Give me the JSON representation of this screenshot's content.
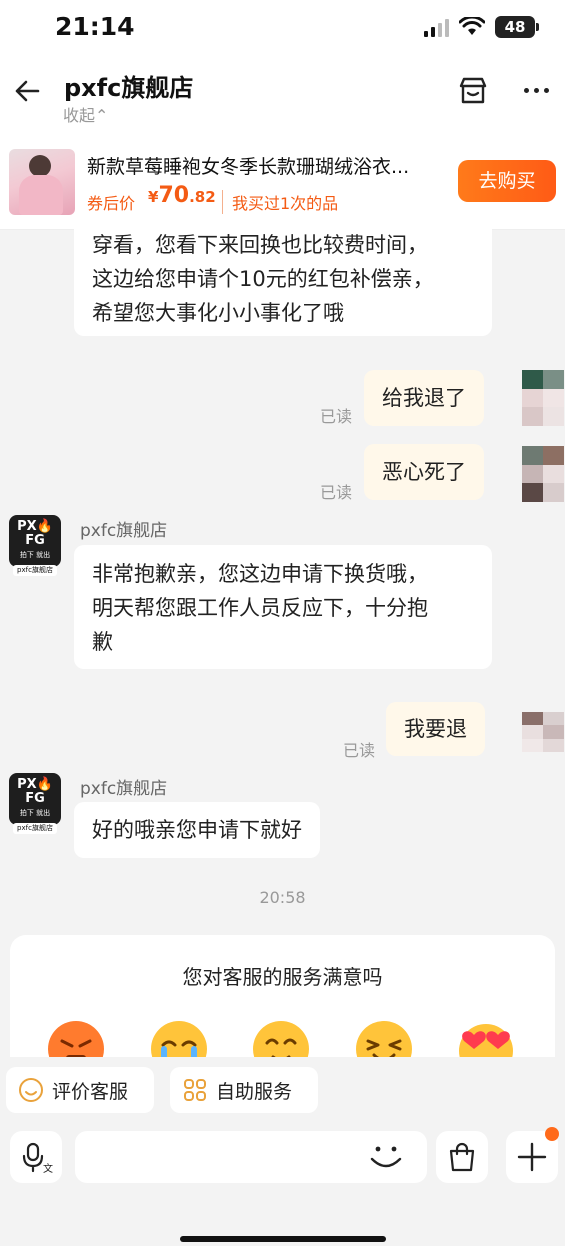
{
  "status": {
    "time": "21:14",
    "battery": "48"
  },
  "header": {
    "shop_name": "pxfc旗舰店",
    "collapse_label": "收起⌃"
  },
  "product": {
    "name": "新款草莓睡袍女冬季长款珊瑚绒浴衣...",
    "price_label": "券后价",
    "price_symbol": "¥",
    "price_int": "70",
    "price_dec": ".82",
    "bought_text": "我买过1次的品",
    "buy_button": "去购买"
  },
  "messages": {
    "m1_line1": "穿看，您看下来回换也比较费时间，",
    "m1_line2": "这边给您申请个10元的红包补偿亲，",
    "m1_line3": "希望您大事化小小事化了哦",
    "m2_read": "已读",
    "m2_text": "给我退了",
    "m3_read": "已读",
    "m3_text": "恶心死了",
    "m4_sender": "pxfc旗舰店",
    "m4_line1": "非常抱歉亲，您这边申请下换货哦，",
    "m4_line2": "明天帮您跟工作人员反应下，十分抱",
    "m4_line3": "歉",
    "m5_read": "已读",
    "m5_text": "我要退",
    "m6_sender": "pxfc旗舰店",
    "m6_text": "好的哦亲您申请下就好",
    "timestamp": "20:58"
  },
  "shop_avatar": {
    "logo": "PX🔥FG",
    "sub": "拍下 就出",
    "tag": "pxfc旗舰店"
  },
  "survey": {
    "title": "您对客服的服务满意吗",
    "icons": [
      "angry-face-icon",
      "crying-face-icon",
      "neutral-face-icon",
      "happy-face-icon",
      "heart-eyes-face-icon"
    ]
  },
  "quick_actions": {
    "rate": "评价客服",
    "self_service": "自助服务"
  },
  "input": {
    "placeholder": ""
  },
  "colors": {
    "accent": "#ff5b16",
    "price": "#f45b14",
    "mine_bubble": "#fff8ea"
  }
}
